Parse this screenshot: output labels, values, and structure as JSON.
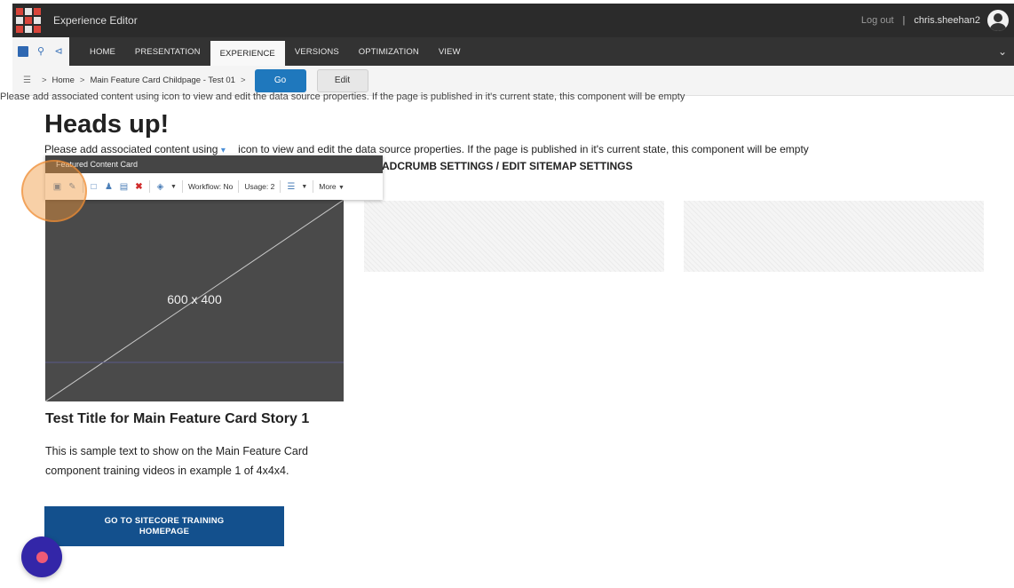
{
  "app": {
    "title": "Experience Editor"
  },
  "user": {
    "logout_label": "Log out",
    "separator": "|",
    "username": "chris.sheehan2"
  },
  "ribbon": {
    "tabs": [
      {
        "label": "HOME"
      },
      {
        "label": "PRESENTATION"
      },
      {
        "label": "EXPERIENCE",
        "active": true
      },
      {
        "label": "VERSIONS"
      },
      {
        "label": "OPTIMIZATION"
      },
      {
        "label": "VIEW"
      }
    ]
  },
  "nav": {
    "breadcrumb": [
      "Home",
      "Main Feature Card Childpage - Test 01"
    ],
    "go_label": "Go",
    "edit_label": "Edit"
  },
  "page": {
    "ghost_notice": "Please add associated content using  icon to view and edit the data source properties. If the page is published in it's current state, this component will be empty",
    "heading": "Heads up!",
    "notice_before": "Please add associated content using",
    "notice_after": "icon to view and edit the data source properties. If the page is published in it's current state, this component will be empty",
    "breadcrumb_settings": "ADCRUMB SETTINGS / EDIT SITEMAP SETTINGS",
    "image_label": "600 x 400",
    "card_title": "Test Title for Main Feature Card Story 1",
    "card_body": "This is sample text to show on the Main Feature Card component training videos in example 1 of 4x4x4.",
    "cta_label": "GO TO SITECORE TRAINING HOMEPAGE"
  },
  "component_toolbar": {
    "title": "Featured Content Card",
    "workflow_label": "Workflow: No",
    "usage_label": "Usage: 2",
    "more_label": "More"
  },
  "colors": {
    "titlebar": "#2b2b2b",
    "ribbon": "#333333",
    "go_button": "#1f78bd",
    "cta": "#13508d",
    "highlight": "#f0963c",
    "fab": "#3326a8"
  }
}
